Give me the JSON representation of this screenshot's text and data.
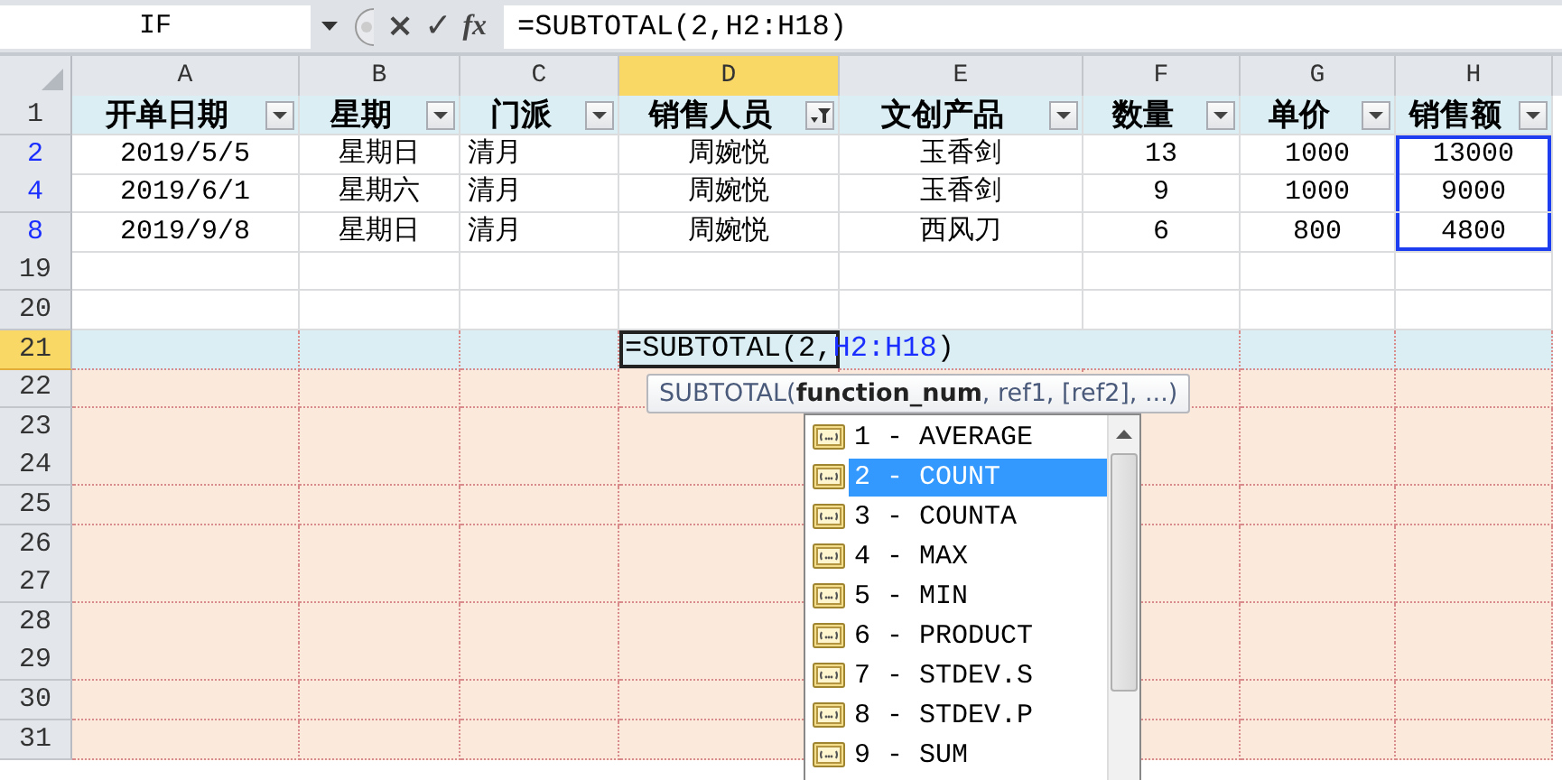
{
  "formula_bar": {
    "name_box": "IF",
    "cancel": "×",
    "enter": "✓",
    "fx": "fx",
    "formula": "=SUBTOTAL(2,H2:H18)"
  },
  "columns": [
    {
      "letter": "A",
      "selected": false
    },
    {
      "letter": "B",
      "selected": false
    },
    {
      "letter": "C",
      "selected": false
    },
    {
      "letter": "D",
      "selected": true
    },
    {
      "letter": "E",
      "selected": false
    },
    {
      "letter": "F",
      "selected": false
    },
    {
      "letter": "G",
      "selected": false
    },
    {
      "letter": "H",
      "selected": false
    }
  ],
  "rows": [
    {
      "number": "1",
      "kind": "header",
      "selected": false,
      "cells": [
        {
          "text": "开单日期",
          "filter_active": false
        },
        {
          "text": "星期",
          "filter_active": false
        },
        {
          "text": "门派",
          "filter_active": false
        },
        {
          "text": "销售人员",
          "filter_active": true
        },
        {
          "text": "文创产品",
          "filter_active": false
        },
        {
          "text": "数量",
          "filter_active": false
        },
        {
          "text": "单价",
          "filter_active": false
        },
        {
          "text": "销售额",
          "filter_active": false
        }
      ]
    },
    {
      "number": "2",
      "kind": "data",
      "selected": false,
      "cells": [
        {
          "text": "2019/5/5",
          "selected": false
        },
        {
          "text": "星期日",
          "selected": false
        },
        {
          "text": "清月",
          "selected": false
        },
        {
          "text": "周婉悦",
          "selected": false
        },
        {
          "text": "玉香剑",
          "selected": false
        },
        {
          "text": "13",
          "selected": false
        },
        {
          "text": "1000",
          "selected": false
        },
        {
          "text": "13000",
          "selected": true
        }
      ]
    },
    {
      "number": "4",
      "kind": "data",
      "selected": false,
      "cells": [
        {
          "text": "2019/6/1",
          "selected": false
        },
        {
          "text": "星期六",
          "selected": false
        },
        {
          "text": "清月",
          "selected": false
        },
        {
          "text": "周婉悦",
          "selected": false
        },
        {
          "text": "玉香剑",
          "selected": false
        },
        {
          "text": "9",
          "selected": false
        },
        {
          "text": "1000",
          "selected": false
        },
        {
          "text": "9000",
          "selected": true
        }
      ]
    },
    {
      "number": "8",
      "kind": "data",
      "selected": false,
      "cells": [
        {
          "text": "2019/9/8",
          "selected": false
        },
        {
          "text": "星期日",
          "selected": false
        },
        {
          "text": "清月",
          "selected": false
        },
        {
          "text": "周婉悦",
          "selected": false
        },
        {
          "text": "西风刀",
          "selected": false
        },
        {
          "text": "6",
          "selected": false
        },
        {
          "text": "800",
          "selected": false
        },
        {
          "text": "4800",
          "selected": true
        }
      ]
    },
    {
      "number": "19",
      "kind": "blank",
      "selected": false
    },
    {
      "number": "20",
      "kind": "blank",
      "selected": false
    },
    {
      "number": "21",
      "kind": "edit",
      "selected": true,
      "formula_parts": [
        {
          "text": "=SUBTOTAL(2,",
          "kind": "plain"
        },
        {
          "text": "H2:H18",
          "kind": "ref"
        },
        {
          "text": ")",
          "kind": "plain"
        }
      ]
    },
    {
      "number": "22",
      "kind": "shaded",
      "selected": false
    },
    {
      "number": "23",
      "kind": "shaded",
      "selected": false
    },
    {
      "number": "24",
      "kind": "shaded",
      "selected": false
    },
    {
      "number": "25",
      "kind": "shaded",
      "selected": false
    },
    {
      "number": "26",
      "kind": "shaded",
      "selected": false
    },
    {
      "number": "27",
      "kind": "shaded",
      "selected": false
    },
    {
      "number": "28",
      "kind": "shaded",
      "selected": false
    },
    {
      "number": "29",
      "kind": "shaded",
      "selected": false
    },
    {
      "number": "30",
      "kind": "shaded",
      "selected": false
    },
    {
      "number": "31",
      "kind": "shaded",
      "selected": false
    }
  ],
  "tooltip": "SUBTOTAL(**function_num**, ref1, [ref2], ...)",
  "autocomplete": [
    {
      "label": "1 - AVERAGE",
      "selected": false
    },
    {
      "label": "2 - COUNT",
      "selected": true
    },
    {
      "label": "3 - COUNTA",
      "selected": false
    },
    {
      "label": "4 - MAX",
      "selected": false
    },
    {
      "label": "5 - MIN",
      "selected": false
    },
    {
      "label": "6 - PRODUCT",
      "selected": false
    },
    {
      "label": "7 - STDEV.S",
      "selected": false
    },
    {
      "label": "8 - STDEV.P",
      "selected": false
    },
    {
      "label": "9 - SUM",
      "selected": false
    }
  ]
}
